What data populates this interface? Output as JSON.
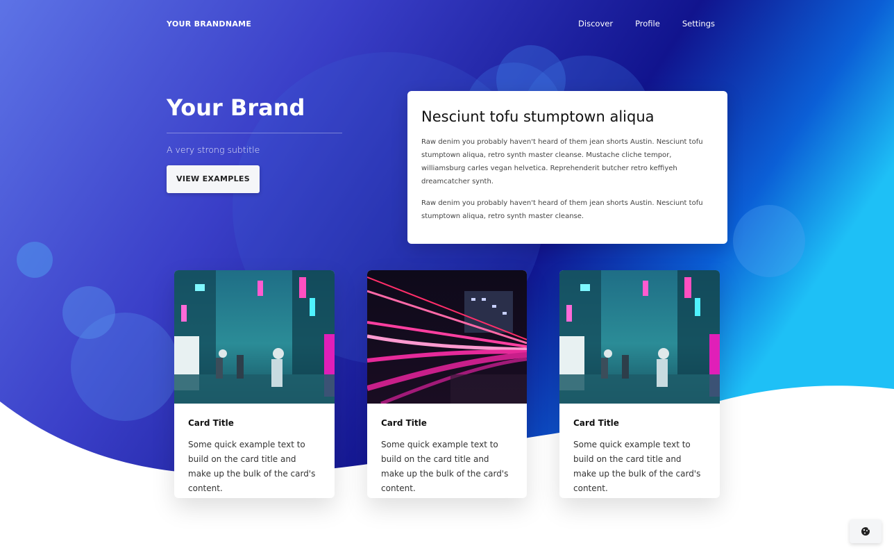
{
  "navbar": {
    "brand": "YOUR BRANDNAME",
    "links": [
      "Discover",
      "Profile",
      "Settings"
    ]
  },
  "hero": {
    "title": "Your Brand",
    "subtitle": "A very strong subtitle",
    "button_label": "VIEW EXAMPLES"
  },
  "info_card": {
    "title": "Nesciunt tofu stumptown aliqua",
    "paragraphs": [
      "Raw denim you probably haven't heard of them jean shorts Austin. Nesciunt tofu stumptown aliqua, retro synth master cleanse. Mustache cliche tempor, williamsburg carles vegan helvetica. Reprehenderit butcher retro keffiyeh dreamcatcher synth.",
      "Raw denim you probably haven't heard of them jean shorts Austin. Nesciunt tofu stumptown aliqua, retro synth master cleanse."
    ]
  },
  "cards": [
    {
      "title": "Card Title",
      "text": "Some quick example text to build on the card title and make up the bulk of the card's content.",
      "image": "neon-street-photo"
    },
    {
      "title": "Card Title",
      "text": "Some quick example text to build on the card title and make up the bulk of the card's content.",
      "image": "light-trails-photo"
    },
    {
      "title": "Card Title",
      "text": "Some quick example text to build on the card title and make up the bulk of the card's content.",
      "image": "neon-street-photo"
    }
  ],
  "colors": {
    "gradient_start": "#5b6be0",
    "gradient_mid": "#1a1fa8",
    "gradient_end": "#1fb6f5",
    "accent_pink": "#ff3caa",
    "accent_cyan": "#3fe0e0"
  },
  "cookie_icon": "cookie-icon"
}
